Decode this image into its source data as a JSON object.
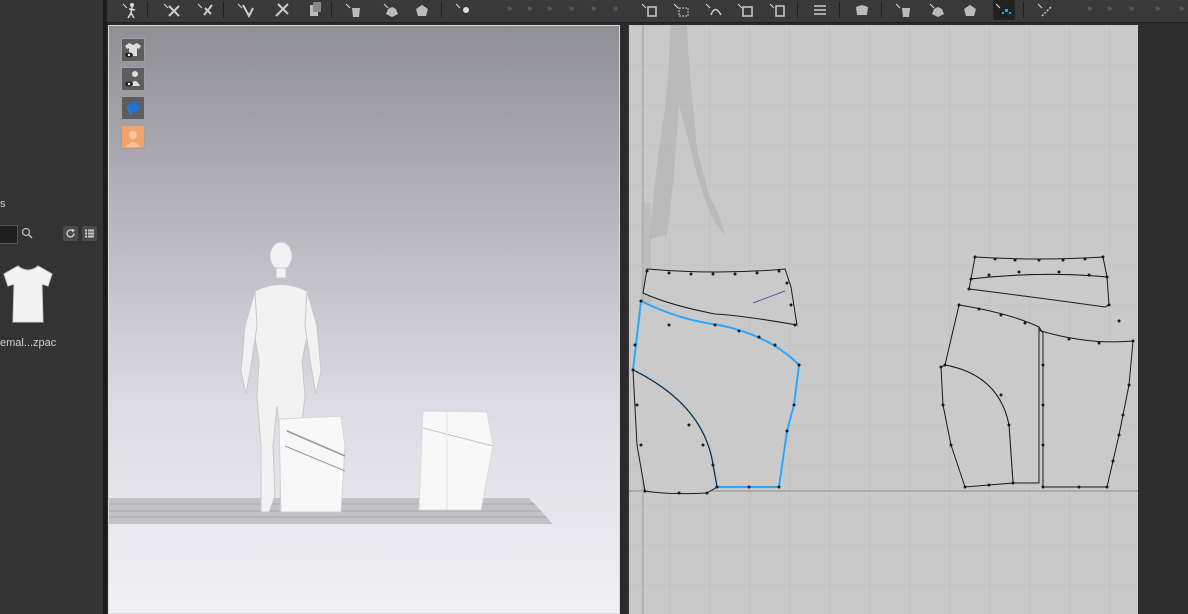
{
  "library": {
    "label": "s",
    "file_name": "emal...zpac"
  },
  "icons": {
    "search": "search-icon",
    "refresh": "refresh-icon",
    "list_view": "list-view-icon",
    "thumbnail": "t-shirt-thumbnail"
  },
  "toolbar": {
    "groups": 12,
    "overflow_glyph": "»"
  },
  "viewport3d": {
    "side_tools": [
      "show-garment-icon",
      "show-avatar-icon",
      "texture-icon",
      "avatar-skin-icon"
    ]
  },
  "colors": {
    "selected_line": "#29a8ff",
    "pattern_line": "#1a1a1a",
    "active_tool": "#00b4ff"
  }
}
